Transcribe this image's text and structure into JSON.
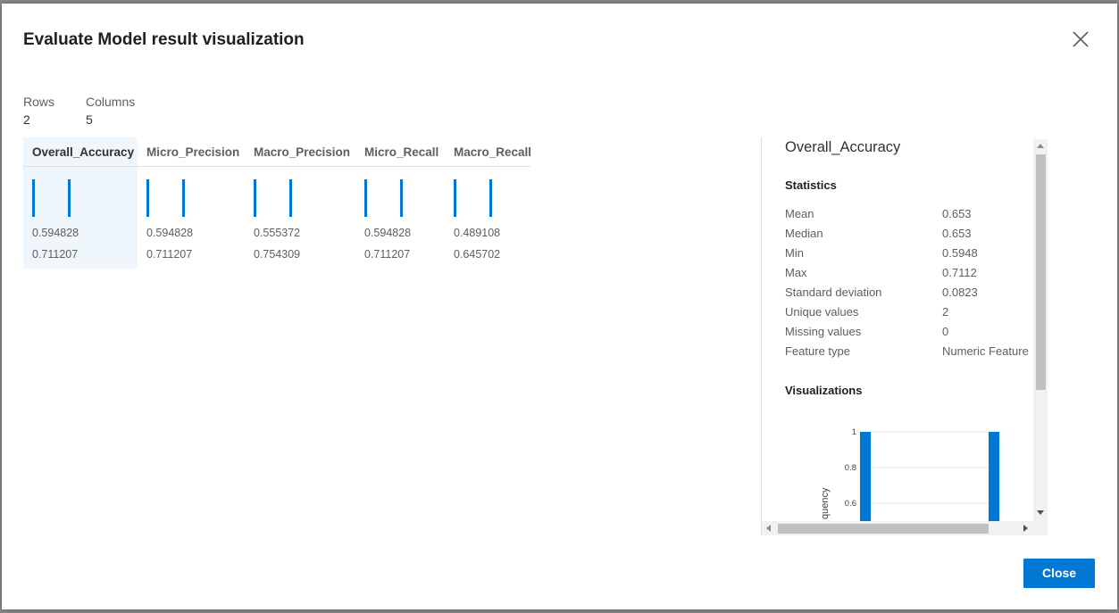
{
  "dialog": {
    "title": "Evaluate Model result visualization",
    "close_label": "Close"
  },
  "summary": {
    "rows_label": "Rows",
    "rows_value": "2",
    "columns_label": "Columns",
    "columns_value": "5"
  },
  "table": {
    "columns": [
      {
        "name": "Overall_Accuracy",
        "values": [
          "0.594828",
          "0.711207"
        ],
        "selected": true
      },
      {
        "name": "Micro_Precision",
        "values": [
          "0.594828",
          "0.711207"
        ],
        "selected": false
      },
      {
        "name": "Macro_Precision",
        "values": [
          "0.555372",
          "0.754309"
        ],
        "selected": false
      },
      {
        "name": "Micro_Recall",
        "values": [
          "0.594828",
          "0.711207"
        ],
        "selected": false
      },
      {
        "name": "Macro_Recall",
        "values": [
          "0.489108",
          "0.645702"
        ],
        "selected": false
      }
    ]
  },
  "panel": {
    "title": "Overall_Accuracy",
    "statistics_heading": "Statistics",
    "stats": [
      {
        "label": "Mean",
        "value": "0.653"
      },
      {
        "label": "Median",
        "value": "0.653"
      },
      {
        "label": "Min",
        "value": "0.5948"
      },
      {
        "label": "Max",
        "value": "0.7112"
      },
      {
        "label": "Standard deviation",
        "value": "0.0823"
      },
      {
        "label": "Unique values",
        "value": "2"
      },
      {
        "label": "Missing values",
        "value": "0"
      },
      {
        "label": "Feature type",
        "value": "Numeric Feature"
      }
    ],
    "visualizations_heading": "Visualizations"
  },
  "chart_data": {
    "type": "bar",
    "ylabel": "quency",
    "y_ticks": [
      "1",
      "0.8",
      "0.6"
    ],
    "ylim": [
      0.5,
      1
    ],
    "values": [
      1,
      1
    ],
    "grid": true
  },
  "colors": {
    "accent": "#0078d4",
    "selected_column_bg": "#eff6fc"
  },
  "icons": {
    "close": "close-icon"
  }
}
